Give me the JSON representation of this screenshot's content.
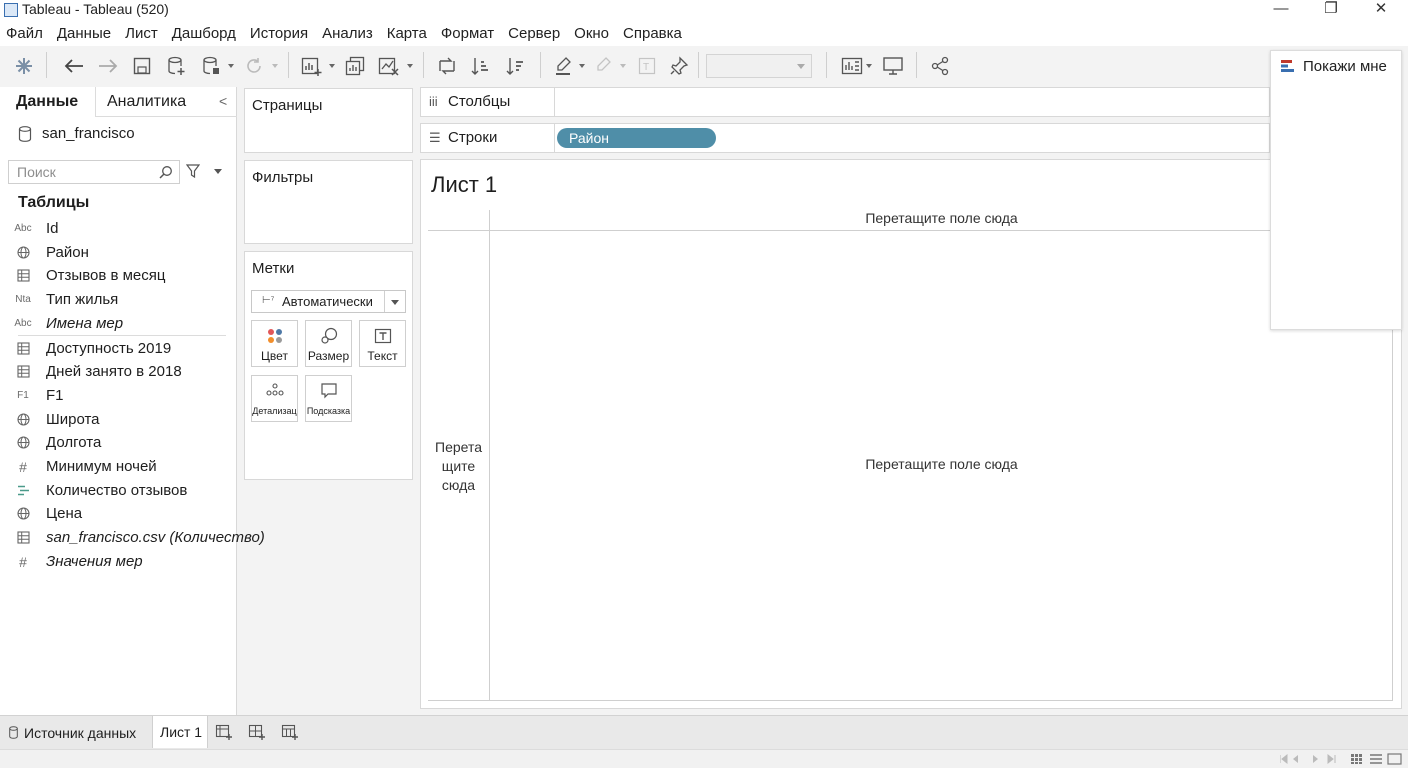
{
  "window": {
    "title": "Tableau - Tableau (520)",
    "controls": {
      "minimize": "—",
      "restore": "❐",
      "close": "✕"
    }
  },
  "menu": [
    "Файл",
    "Данные",
    "Лист",
    "Дашборд",
    "История",
    "Анализ",
    "Карта",
    "Формат",
    "Сервер",
    "Окно",
    "Справка"
  ],
  "toolbar": {
    "icons": [
      "tableau-logo-icon",
      "undo-icon",
      "redo-icon",
      "save-icon",
      "new-datasource-icon",
      "pause-updates-icon",
      "refresh-icon",
      "new-worksheet-icon",
      "duplicate-sheet-icon",
      "clear-sheet-icon",
      "swap-rows-columns-icon",
      "sort-ascending-icon",
      "sort-descending-icon",
      "highlight-icon",
      "group-members-icon",
      "show-mark-labels-icon",
      "pin-axes-icon",
      "fit-combo",
      "show-cards-icon",
      "presentation-mode-icon",
      "share-icon"
    ]
  },
  "show_me": {
    "label": "Покажи мне"
  },
  "data_pane": {
    "tabs": {
      "data": "Данные",
      "analytics": "Аналитика",
      "collapse": "<"
    },
    "datasource": "san_francisco",
    "search": {
      "placeholder": "Поиск",
      "value": ""
    },
    "tables_heading": "Таблицы",
    "dimensions": [
      {
        "type_icon": "Abc",
        "name": "Id",
        "italic": false
      },
      {
        "type_icon": "globe",
        "name": "Район",
        "italic": false
      },
      {
        "type_icon": "table",
        "name": "Отзывов в месяц",
        "italic": false
      },
      {
        "type_icon": "Nta",
        "name": "Тип жилья",
        "italic": false
      },
      {
        "type_icon": "Abc",
        "name": "Имена мер",
        "italic": true
      }
    ],
    "measures": [
      {
        "type_icon": "table",
        "name": "Доступность 2019",
        "italic": false
      },
      {
        "type_icon": "table",
        "name": "Дней занято в 2018",
        "italic": false
      },
      {
        "type_icon": "F1",
        "name": "F1",
        "italic": false
      },
      {
        "type_icon": "globe",
        "name": "Широта",
        "italic": false
      },
      {
        "type_icon": "globe",
        "name": "Долгота",
        "italic": false
      },
      {
        "type_icon": "#",
        "name": "Минимум ночей",
        "italic": false
      },
      {
        "type_icon": "bins",
        "name": "Количество отзывов",
        "italic": false
      },
      {
        "type_icon": "globe",
        "name": "Цена",
        "italic": false
      },
      {
        "type_icon": "table",
        "name": "san_francisco.csv (Количество)",
        "italic": true
      },
      {
        "type_icon": "#",
        "name": "Значения мер",
        "italic": true
      }
    ]
  },
  "cards": {
    "pages": "Страницы",
    "filters": "Фильтры",
    "marks": {
      "title": "Метки",
      "type": "Автоматически",
      "buttons": [
        "Цвет",
        "Размер",
        "Текст",
        "Детализац",
        "Подсказка"
      ]
    }
  },
  "shelves": {
    "columns": {
      "label": "Столбцы",
      "pills": []
    },
    "rows": {
      "label": "Строки",
      "pills": [
        "Район"
      ]
    }
  },
  "view": {
    "sheet_title": "Лист 1",
    "columns_drop": "Перетащите поле сюда",
    "rows_drop_lines": [
      "Перета",
      "щите",
      "сюда"
    ],
    "cell_drop": "Перетащите поле сюда"
  },
  "bottom_tabs": {
    "datasource": "Источник данных",
    "sheet": "Лист 1",
    "new_icons": [
      "new-worksheet-tab-icon",
      "new-dashboard-tab-icon",
      "new-story-tab-icon"
    ]
  },
  "colors": {
    "pill": "#4f8ea8",
    "toolbar_bg": "#f3f3f3",
    "pane_bg": "#ffffff",
    "border": "#d8d8d8"
  }
}
